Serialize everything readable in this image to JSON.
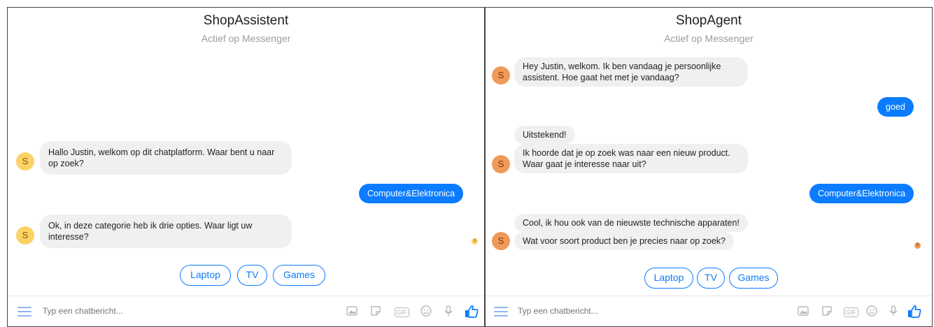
{
  "left": {
    "title": "ShopAssistent",
    "subtitle": "Actief op Messenger",
    "avatar_letter": "S",
    "messages": [
      "Hallo Justin, welkom op dit chatplatform. Waar bent u naar op zoek?",
      "Computer&Elektronica",
      "Ok, in deze categorie heb ik drie opties. Waar ligt uw interesse?"
    ],
    "quick_replies": [
      "Laptop",
      "TV",
      "Games"
    ],
    "composer_placeholder": "Typ een chatbericht..."
  },
  "right": {
    "title": "ShopAgent",
    "subtitle": "Actief op Messenger",
    "avatar_letter": "S",
    "messages": [
      "Hey Justin, welkom. Ik ben vandaag je persoonlijke assistent. Hoe gaat het met je vandaag?",
      "goed",
      "Uitstekend!",
      "Ik hoorde dat je op zoek was naar een nieuw product. Waar gaat je interesse naar uit?",
      "Computer&Elektronica",
      "Cool, ik hou ook van de nieuwste technische apparaten!",
      "Wat voor soort product ben je precies naar op zoek?"
    ],
    "quick_replies": [
      "Laptop",
      "TV",
      "Games"
    ],
    "composer_placeholder": "Typ een chatbericht..."
  },
  "composer_icons": [
    "menu-icon",
    "image-icon",
    "sticker-icon",
    "gif-icon",
    "emoji-icon",
    "microphone-icon",
    "thumbs-up-icon"
  ],
  "gif_label": "GIF",
  "colors": {
    "accent": "#0b7cff",
    "incoming_bubble": "#f1f0f0",
    "avatar_left": "#fbd265",
    "avatar_right": "#f09a5a"
  }
}
